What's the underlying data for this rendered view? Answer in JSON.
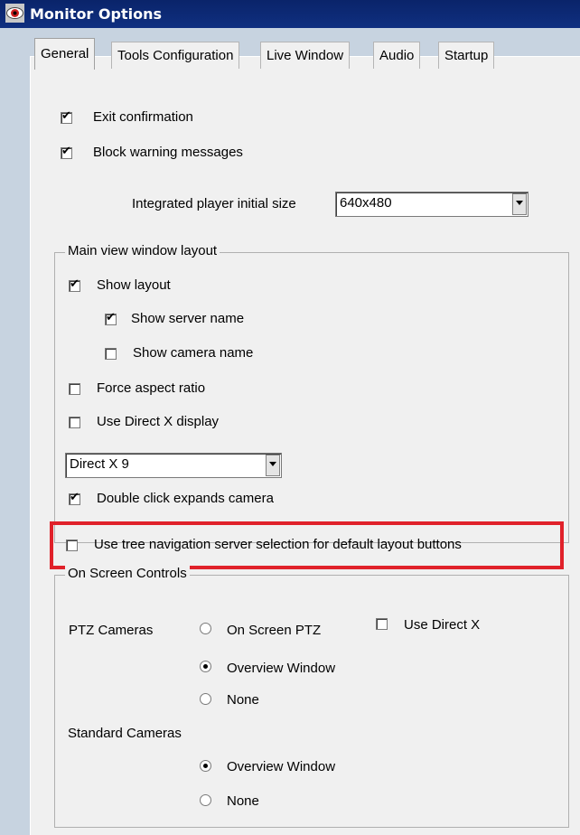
{
  "window": {
    "title": "Monitor Options"
  },
  "tabs": [
    "General",
    "Tools Configuration",
    "Live Window",
    "Audio",
    "Startup"
  ],
  "general": {
    "exit_confirmation": {
      "label": "Exit confirmation",
      "checked": true
    },
    "block_warning_messages": {
      "label": "Block warning messages",
      "checked": true
    },
    "player_size": {
      "label": "Integrated player initial size",
      "value": "640x480"
    }
  },
  "main_view": {
    "title": "Main view window layout",
    "show_layout": {
      "label": "Show layout",
      "checked": true
    },
    "show_server_name": {
      "label": "Show server name",
      "checked": true
    },
    "show_camera_name": {
      "label": "Show camera name",
      "checked": false
    },
    "force_aspect_ratio": {
      "label": "Force aspect ratio",
      "checked": false
    },
    "use_directx_display": {
      "label": "Use Direct X display",
      "checked": false
    },
    "directx_version": "Direct X 9",
    "double_click": {
      "label": "Double click expands camera",
      "checked": true
    },
    "tree_navigation": {
      "label": "Use tree navigation server selection for default layout buttons",
      "checked": false
    }
  },
  "on_screen": {
    "title": "On Screen Controls",
    "ptz_label": "PTZ Cameras",
    "ptz_on_screen": "On Screen PTZ",
    "use_directx": "Use Direct X",
    "ptz_overview": "Overview Window",
    "ptz_none": "None",
    "standard_label": "Standard Cameras",
    "std_overview": "Overview Window",
    "std_none": "None"
  },
  "colors": {
    "highlight": "#e0212a",
    "titlebar": "#0a246a",
    "background": "#c7d3e0"
  }
}
